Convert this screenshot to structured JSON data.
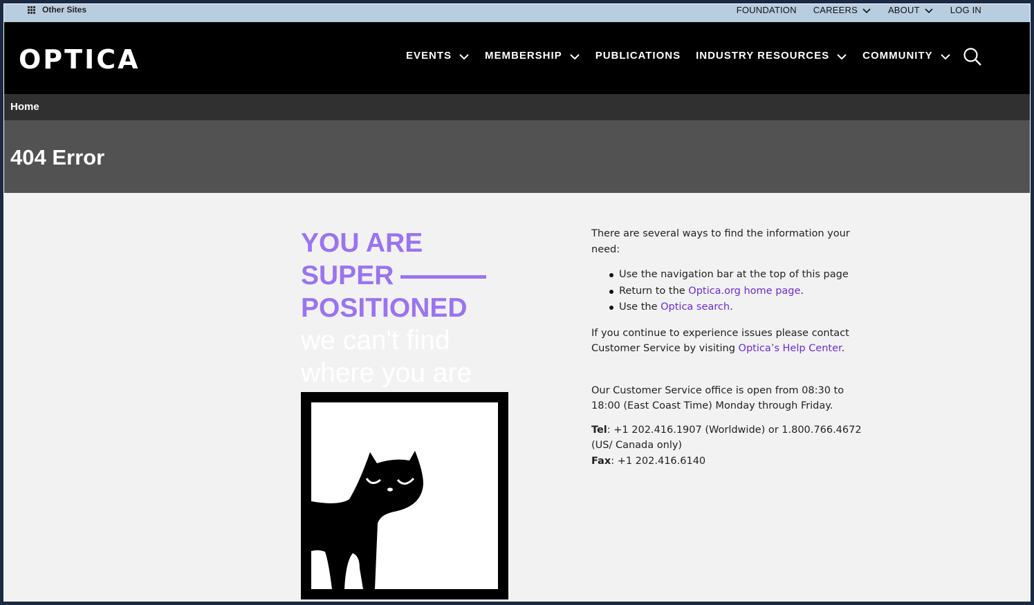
{
  "utility_bar": {
    "other_sites_label": "Other Sites",
    "links": [
      {
        "label": "FOUNDATION",
        "has_dropdown": false
      },
      {
        "label": "CAREERS",
        "has_dropdown": true
      },
      {
        "label": "ABOUT",
        "has_dropdown": true
      },
      {
        "label": "LOG IN",
        "has_dropdown": false
      }
    ]
  },
  "header": {
    "logo_text": "OPTICA",
    "nav": [
      {
        "label": "EVENTS",
        "has_dropdown": true
      },
      {
        "label": "MEMBERSHIP",
        "has_dropdown": true
      },
      {
        "label": "PUBLICATIONS",
        "has_dropdown": false
      },
      {
        "label": "INDUSTRY RESOURCES",
        "has_dropdown": true
      },
      {
        "label": "COMMUNITY",
        "has_dropdown": true
      }
    ],
    "search_icon": "search-icon"
  },
  "breadcrumb": {
    "home_label": "Home"
  },
  "page_title": "404 Error",
  "hero": {
    "line1": "YOU ARE",
    "line2": "SUPER",
    "line3": "POSITIONED",
    "sub1": "we can't find",
    "sub2": "where you are"
  },
  "info": {
    "intro": "There are several ways to find the information your need:",
    "bullets": {
      "b1": "Use the navigation bar at the top of this page",
      "b2_pre": "Return to the ",
      "b2_link": "Optica.org home page",
      "b2_post": ".",
      "b3_pre": "Use the ",
      "b3_link": "Optica search",
      "b3_post": "."
    },
    "contact_pre": "If you continue to experience issues please contact Customer Service by visiting ",
    "contact_link": "Optica’s Help Center",
    "contact_post": ".",
    "hours": "Our Customer Service office is open from 08:30 to 18:00 (East Coast Time) Monday through Friday.",
    "tel_label": "Tel",
    "tel_value": ": +1 202.416.1907 (Worldwide) or 1.800.766.4672 (US/ Canada only)",
    "fax_label": "Fax",
    "fax_value": ": +1 202.416.6140"
  },
  "colors": {
    "accent_purple": "#9a74f0",
    "link_purple": "#6b2bd1",
    "utility_bg": "#b9cde0"
  }
}
